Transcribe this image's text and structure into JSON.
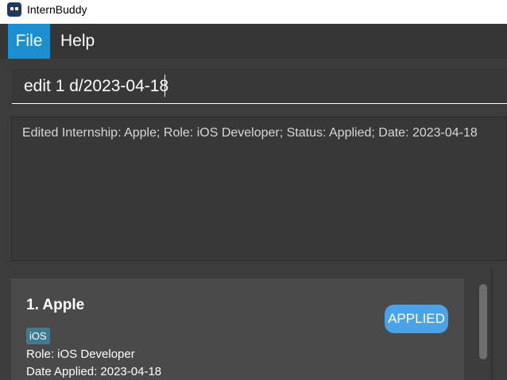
{
  "window": {
    "title": "InternBuddy",
    "icon": "robot-icon"
  },
  "menu": {
    "file_label": "File",
    "help_label": "Help"
  },
  "command": {
    "value": "edit 1 d/2023-04-18"
  },
  "result": {
    "text": "Edited Internship: Apple; Role: iOS Developer; Status: Applied; Date: 2023-04-18"
  },
  "internships": [
    {
      "title": "1.  Apple",
      "tag": "iOS",
      "role_line": "Role: iOS Developer",
      "date_line": "Date Applied: 2023-04-18",
      "status": "APPLIED"
    }
  ],
  "colors": {
    "accent": "#1b8fcf",
    "status_applied": "#4aa3e8",
    "tag": "#3e7b91",
    "background": "#3c3c3c"
  }
}
